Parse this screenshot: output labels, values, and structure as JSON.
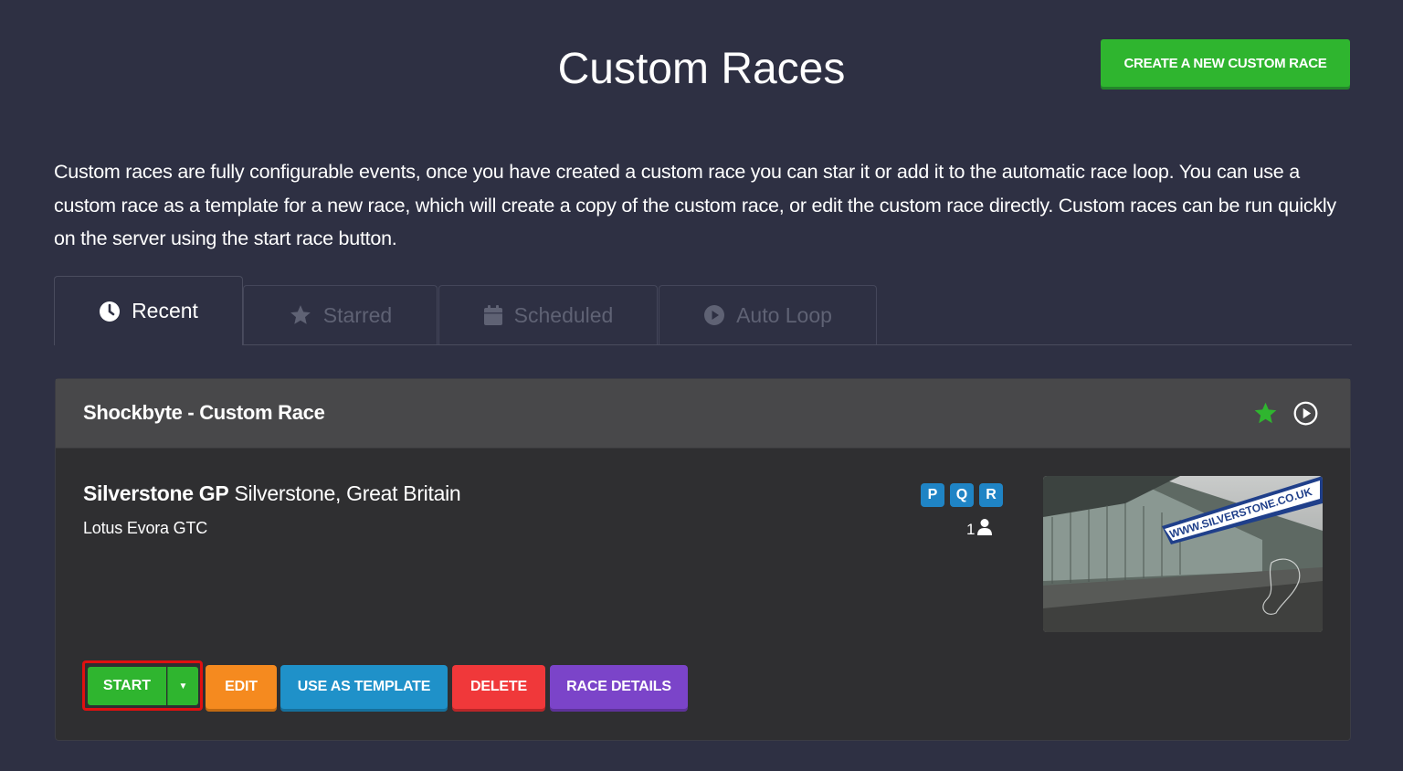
{
  "header": {
    "title": "Custom Races",
    "create_button_label": "CREATE A NEW CUSTOM RACE"
  },
  "intro": {
    "text": "Custom races are fully configurable events, once you have created a custom race you can star it or add it to the automatic race loop. You can use a custom race as a template for a new race, which will create a copy of the custom race, or edit the custom race directly. Custom races can be run quickly on the server using the start race button."
  },
  "tabs": [
    {
      "label": "Recent",
      "icon": "clock-icon",
      "active": true
    },
    {
      "label": "Starred",
      "icon": "star-icon",
      "active": false
    },
    {
      "label": "Scheduled",
      "icon": "calendar-icon",
      "active": false
    },
    {
      "label": "Auto Loop",
      "icon": "play-circle-icon",
      "active": false
    }
  ],
  "race": {
    "title": "Shockbyte - Custom Race",
    "track_name": "Silverstone GP",
    "track_location": "Silverstone, Great Britain",
    "car": "Lotus Evora GTC",
    "sessions": [
      "P",
      "Q",
      "R"
    ],
    "driver_count": "1",
    "image_banner_text": "WWW.SILVERSTONE.CO.UK",
    "starred": true
  },
  "actions": {
    "start": "START",
    "edit": "EDIT",
    "use_as_template": "USE AS TEMPLATE",
    "delete": "DELETE",
    "race_details": "RACE DETAILS"
  },
  "colors": {
    "background": "#2e3043",
    "panel": "#2f2f31",
    "panel_header": "#48484a",
    "green": "#2fb52f",
    "orange": "#f58a1f",
    "blue": "#1f91c9",
    "red": "#f0383a",
    "purple": "#7b44c9",
    "badge_blue": "#1f84c5",
    "highlight_border": "#e01010"
  }
}
